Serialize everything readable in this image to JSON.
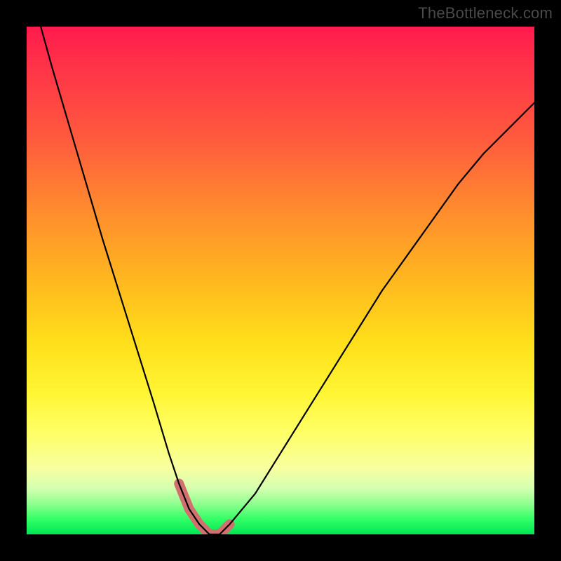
{
  "watermark": "TheBottleneck.com",
  "chart_data": {
    "type": "line",
    "title": "",
    "xlabel": "",
    "ylabel": "",
    "xlim": [
      0,
      100
    ],
    "ylim": [
      0,
      100
    ],
    "grid": false,
    "legend": false,
    "series": [
      {
        "name": "bottleneck-curve",
        "x": [
          0,
          5,
          10,
          15,
          20,
          25,
          28,
          30,
          32,
          34,
          36,
          38,
          40,
          45,
          50,
          55,
          60,
          65,
          70,
          75,
          80,
          85,
          90,
          95,
          100
        ],
        "y": [
          110,
          92,
          75,
          58,
          42,
          26,
          16,
          10,
          5,
          2,
          0,
          0,
          2,
          8,
          16,
          24,
          32,
          40,
          48,
          55,
          62,
          69,
          75,
          80,
          85
        ]
      },
      {
        "name": "highlight-segment",
        "x": [
          30,
          32,
          34,
          36,
          38,
          40
        ],
        "y": [
          10,
          5,
          2,
          0,
          0,
          2
        ]
      }
    ],
    "annotations": []
  },
  "colors": {
    "curve": "#000000",
    "highlight": "#d1716f",
    "highlight_width": 14
  }
}
